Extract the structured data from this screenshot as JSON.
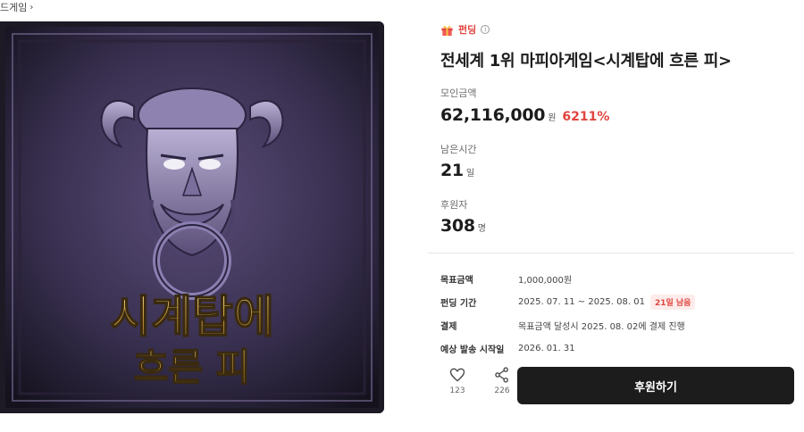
{
  "breadcrumb": {
    "label": "드게임"
  },
  "hero": {
    "logo_line1": "시계탑에",
    "logo_line2": "흐른 피"
  },
  "category": {
    "label": "펀딩",
    "icon": "gift-icon"
  },
  "project": {
    "title": "전세계 1위 마피아게임<시계탑에 흐른 피>"
  },
  "stats": {
    "raised": {
      "label": "모인금액",
      "value": "62,116,000",
      "unit": "원",
      "percent": "6211%"
    },
    "remaining": {
      "label": "남은시간",
      "value": "21",
      "unit": "일"
    },
    "backers": {
      "label": "후원자",
      "value": "308",
      "unit": "명"
    }
  },
  "details": {
    "goal": {
      "key": "목표금액",
      "value": "1,000,000원"
    },
    "period": {
      "key": "펀딩 기간",
      "value": "2025. 07. 11 ~ 2025. 08. 01",
      "badge": "21일 남음"
    },
    "payment": {
      "key": "결제",
      "value": "목표금액 달성시 2025. 08. 02에 결제 진행"
    },
    "shipping": {
      "key": "예상 발송 시작일",
      "value": "2026. 01. 31"
    }
  },
  "actions": {
    "like_count": "123",
    "share_count": "226",
    "support_label": "후원하기"
  },
  "colors": {
    "accent": "#e2443f",
    "cta": "#1c1c1c",
    "artwork_purple": "#3a3152",
    "logo_gold": "#d8b25a"
  }
}
